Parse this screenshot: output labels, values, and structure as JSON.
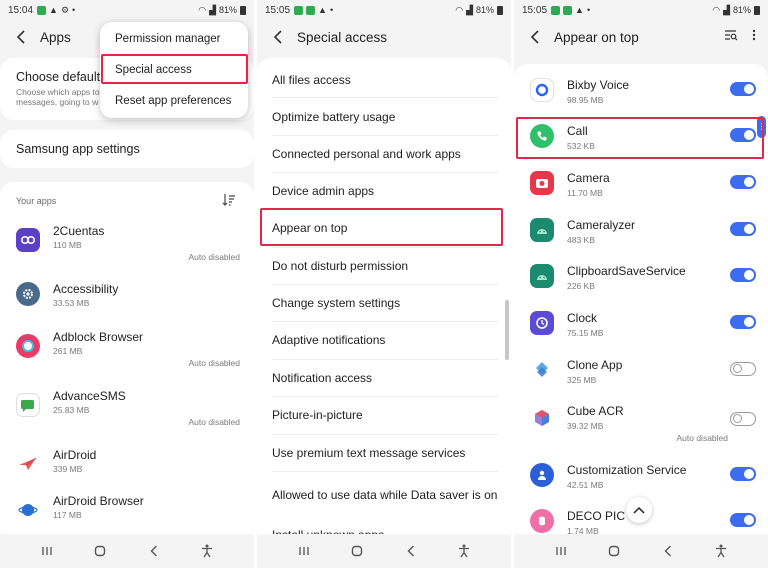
{
  "accent_color": "#3d6cf0",
  "highlight_color": "#e0284a",
  "panel1": {
    "status_time": "15:04",
    "battery": "81%",
    "title": "Apps",
    "choose_default_title": "Choose default",
    "choose_default_desc_1": "Choose which apps to",
    "choose_default_desc_2": "messages, going to w",
    "dropdown": [
      "Permission manager",
      "Special access",
      "Reset app preferences"
    ],
    "samsung_settings": "Samsung app settings",
    "your_apps_label": "Your apps",
    "apps": [
      {
        "name": "2Cuentas",
        "size": "110 MB",
        "status": "Auto disabled"
      },
      {
        "name": "Accessibility",
        "size": "33.53 MB",
        "status": ""
      },
      {
        "name": "Adblock Browser",
        "size": "261 MB",
        "status": "Auto disabled"
      },
      {
        "name": "AdvanceSMS",
        "size": "25.83 MB",
        "status": "Auto disabled"
      },
      {
        "name": "AirDroid",
        "size": "339 MB",
        "status": ""
      },
      {
        "name": "AirDroid Browser",
        "size": "117 MB",
        "status": ""
      }
    ]
  },
  "panel2": {
    "status_time": "15:05",
    "battery": "81%",
    "title": "Special access",
    "items": [
      "All files access",
      "Optimize battery usage",
      "Connected personal and work apps",
      "Device admin apps",
      "Appear on top",
      "Do not disturb permission",
      "Change system settings",
      "Adaptive notifications",
      "Notification access",
      "Picture-in-picture",
      "Use premium text message services",
      "Allowed to use data while Data saver is on",
      "Install unknown apps"
    ]
  },
  "panel3": {
    "status_time": "15:05",
    "battery": "81%",
    "title": "Appear on top",
    "apps": [
      {
        "name": "Bixby Voice",
        "size": "98.95 MB",
        "on": true,
        "status": ""
      },
      {
        "name": "Call",
        "size": "532 KB",
        "on": true,
        "status": ""
      },
      {
        "name": "Camera",
        "size": "11.70 MB",
        "on": true,
        "status": ""
      },
      {
        "name": "Cameralyzer",
        "size": "483 KB",
        "on": true,
        "status": ""
      },
      {
        "name": "ClipboardSaveService",
        "size": "226 KB",
        "on": true,
        "status": ""
      },
      {
        "name": "Clock",
        "size": "75.15 MB",
        "on": true,
        "status": ""
      },
      {
        "name": "Clone App",
        "size": "325 MB",
        "on": false,
        "status": ""
      },
      {
        "name": "Cube ACR",
        "size": "39.32 MB",
        "on": false,
        "status": "Auto disabled"
      },
      {
        "name": "Customization Service",
        "size": "42.51 MB",
        "on": true,
        "status": ""
      },
      {
        "name": "DECO PIC",
        "size": "1.74 MB",
        "on": true,
        "status": ""
      }
    ]
  }
}
